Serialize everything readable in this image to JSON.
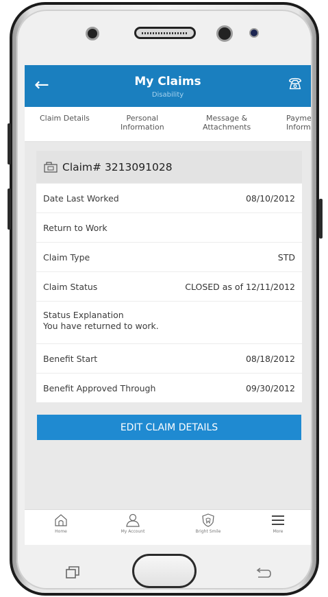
{
  "header": {
    "title": "My Claims",
    "subtitle": "Disability"
  },
  "tabs": [
    {
      "line1": "Claim Details",
      "line2": ""
    },
    {
      "line1": "Personal",
      "line2": "Information"
    },
    {
      "line1": "Message &",
      "line2": "Attachments"
    },
    {
      "line1": "Payme",
      "line2": "Informa"
    }
  ],
  "claim": {
    "heading": "Claim# 3213091028",
    "rows": [
      {
        "label": "Date Last Worked",
        "value": "08/10/2012"
      },
      {
        "label": "Return to Work",
        "value": ""
      },
      {
        "label": "Claim Type",
        "value": "STD"
      },
      {
        "label": "Claim Status",
        "value": "CLOSED as of 12/11/2012"
      },
      {
        "label": "Status Explanation",
        "value": "You have returned to work."
      },
      {
        "label": "Benefit Start",
        "value": "08/18/2012"
      },
      {
        "label": "Benefit Approved Through",
        "value": "09/30/2012"
      }
    ]
  },
  "edit_button": "EDIT CLAIM DETAILS",
  "bottom_nav": [
    {
      "label": "Home",
      "icon": "home-icon"
    },
    {
      "label": "My Account",
      "icon": "user-icon"
    },
    {
      "label": "Bright Smile",
      "icon": "tooth-shield-icon"
    },
    {
      "label": "More",
      "icon": "menu-icon"
    }
  ],
  "colors": {
    "header": "#1a7fbf",
    "button": "#1f8ad1"
  }
}
